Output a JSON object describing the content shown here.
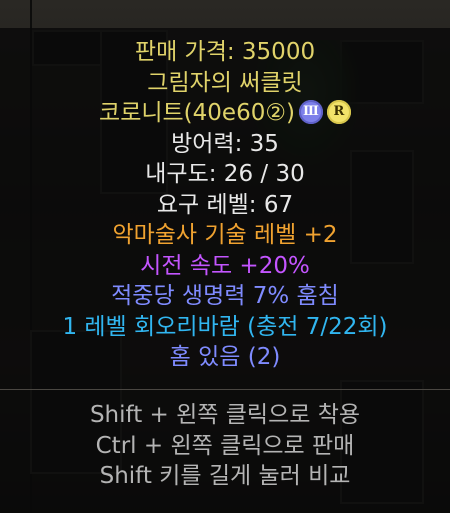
{
  "tooltip": {
    "price": "판매 가격: 35000",
    "name": "그림자의 써클릿",
    "base_type": "코로니트(40e60②)",
    "tier_badge": "Ⅲ",
    "rank_badge": "R",
    "defense": "방어력: 35",
    "durability": "내구도: 26 / 30",
    "level_req": "요구 레벨: 67",
    "mods": [
      "악마술사 기술 레벨 +2",
      "시전 속도 +20%",
      "적중당 생명력 7% 훔침",
      "1 레벨 회오리바람 (충전 7/22회)",
      "홈 있음 (2)"
    ],
    "hints": [
      "Shift + 왼쪽 클릭으로 착용",
      "Ctrl + 왼쪽 클릭으로 판매",
      "Shift 키를 길게 눌러 비교"
    ]
  },
  "colors": {
    "gold": "#e0d36a",
    "white": "#e8e8e8",
    "orange": "#f0a230",
    "purple": "#c455ff",
    "blue": "#7f8bff",
    "cyan": "#31b6f0",
    "gray": "#b4b4b4"
  }
}
